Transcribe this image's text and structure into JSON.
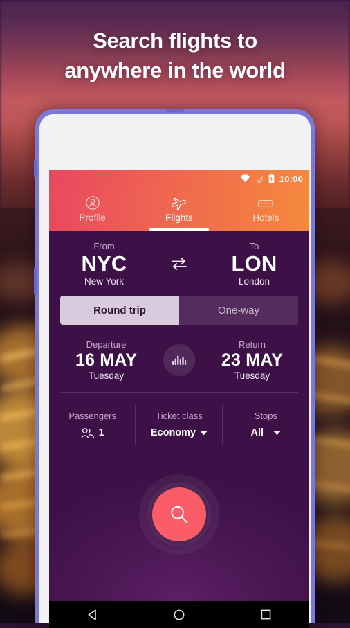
{
  "headline": {
    "line1": "Search flights to",
    "line2": "anywhere in the world"
  },
  "phone": {
    "statusbar": {
      "time": "10:00",
      "icons": [
        "wifi-icon",
        "signal-off-icon",
        "battery-charging-icon"
      ]
    },
    "tabs": [
      {
        "label": "Profile",
        "icon": "profile-icon",
        "active": false
      },
      {
        "label": "Flights",
        "icon": "airplane-icon",
        "active": true
      },
      {
        "label": "Hotels",
        "icon": "bed-icon",
        "active": false
      }
    ],
    "route": {
      "from": {
        "label": "From",
        "code": "NYC",
        "city": "New York"
      },
      "to": {
        "label": "To",
        "code": "LON",
        "city": "London"
      },
      "swap_icon": "swap-arrows-icon"
    },
    "trip_type": {
      "options": [
        "Round trip",
        "One-way"
      ],
      "selected": "Round trip"
    },
    "dates": {
      "departure": {
        "label": "Departure",
        "date": "16 MAY",
        "weekday": "Tuesday"
      },
      "return": {
        "label": "Return",
        "date": "23 MAY",
        "weekday": "Tuesday"
      },
      "price_chart_icon": "bar-chart-icon"
    },
    "options": [
      {
        "label": "Passengers",
        "value": "1",
        "icon": "passengers-icon",
        "caret": false
      },
      {
        "label": "Ticket class",
        "value": "Economy",
        "icon": "",
        "caret": true
      },
      {
        "label": "Stops",
        "value": "All",
        "icon": "",
        "caret": true
      }
    ],
    "search_button": {
      "icon": "search-icon",
      "color": "#fa5c68"
    },
    "navbar": [
      {
        "name": "back",
        "icon": "back-triangle-icon"
      },
      {
        "name": "home",
        "icon": "home-circle-icon"
      },
      {
        "name": "recents",
        "icon": "recents-square-icon"
      }
    ]
  },
  "colors": {
    "accent_pink": "#e9495f",
    "accent_orange": "#f5883c",
    "app_purple": "#4a1653",
    "fab_coral": "#fa5c68",
    "phone_frame": "#7b79d6"
  }
}
